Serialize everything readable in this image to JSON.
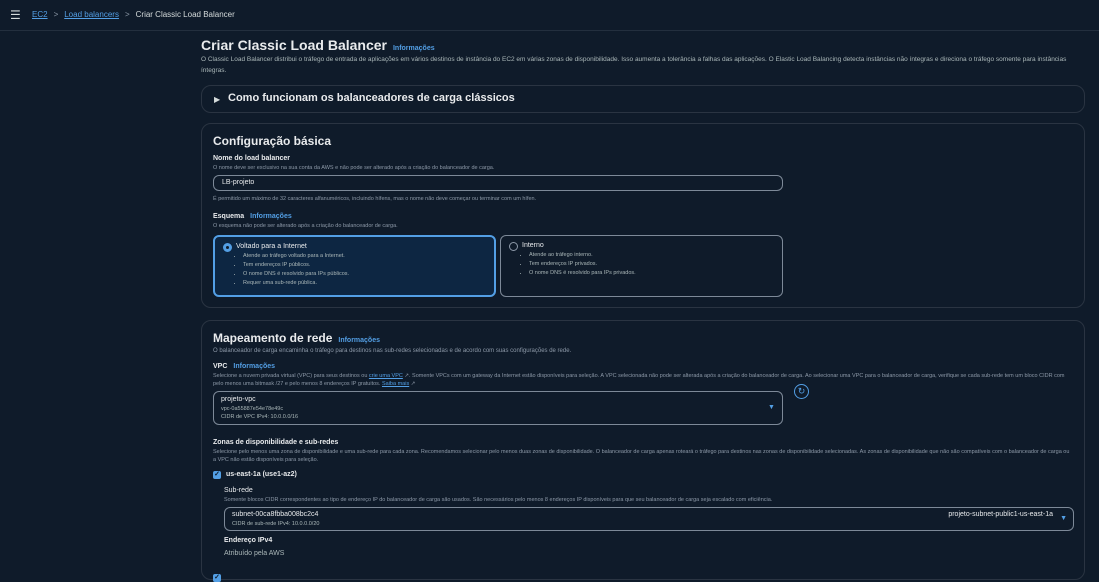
{
  "breadcrumb": {
    "root": "EC2",
    "parent": "Load balancers",
    "current": "Criar Classic Load Balancer"
  },
  "page": {
    "title": "Criar Classic Load Balancer",
    "info": "Informações",
    "intro": "O Classic Load Balancer distribui o tráfego de entrada de aplicações em vários destinos de instância do EC2 em várias zonas de disponibilidade. Isso aumenta a tolerância a falhas das aplicações. O Elastic Load Balancing detecta instâncias não íntegras e direciona o tráfego somente para instâncias íntegras."
  },
  "howto": {
    "label": "Como funcionam os balanceadores de carga clássicos"
  },
  "basic": {
    "title": "Configuração básica",
    "name_label": "Nome do load balancer",
    "name_desc": "O nome deve ser exclusivo na sua conta da AWS e não pode ser alterado após a criação do balanceador de carga.",
    "name_value": "LB-projeto",
    "name_hint": "É permitido um máximo de 32 caracteres alfanuméricos, incluindo hífens, mas o nome não deve começar ou terminar com um hífen.",
    "scheme_label": "Esquema",
    "scheme_info": "Informações",
    "scheme_desc": "O esquema não pode ser alterado após a criação do balanceador de carga.",
    "internet": {
      "title": "Voltado para a Internet",
      "items": [
        "Atende ao tráfego voltado para a Internet.",
        "Tem endereços IP públicos.",
        "O nome DNS é resolvido para IPs públicos.",
        "Requer uma sub-rede pública."
      ]
    },
    "internal": {
      "title": "Interno",
      "items": [
        "Atende ao tráfego interno.",
        "Tem endereços IP privados.",
        "O nome DNS é resolvido para IPs privados."
      ]
    }
  },
  "network": {
    "title": "Mapeamento de rede",
    "info": "Informações",
    "desc": "O balanceador de carga encaminha o tráfego para destinos nas sub-redes selecionadas e de acordo com suas configurações de rede.",
    "vpc_label": "VPC",
    "vpc_info": "Informações",
    "vpc_desc_a": "Selecione a nuvem privada virtual (VPC) para seus destinos ou",
    "vpc_desc_link": "crie uma VPC",
    "vpc_desc_b": ". Somente VPCs com um gateway da Internet estão disponíveis para seleção. A VPC selecionada não pode ser alterada após a criação do balanceador de carga. Ao selecionar uma VPC para o balanceador de carga, verifique se cada sub-rede tem um bloco CIDR com pelo menos uma bitmask /27 e pelo menos 8 endereços IP gratuitos.",
    "vpc_learn": "Saiba mais",
    "vpc_name": "projeto-vpc",
    "vpc_id": "vpc-0a55887e54e78e49c",
    "vpc_cidr": "CIDR de VPC IPv4: 10.0.0.0/16",
    "az_label": "Zonas de disponibilidade e sub-redes",
    "az_desc": "Selecione pelo menos uma zona de disponibilidade e uma sub-rede para cada zona. Recomendamos selecionar pelo menos duas zonas de disponibilidade. O balanceador de carga apenas roteará o tráfego para destinos nas zonas de disponibilidade selecionadas. As zonas de disponibilidade que não são compatíveis com o balanceador de carga ou a VPC não estão disponíveis para seleção.",
    "az_name": "us-east-1a (use1-az2)",
    "subnet_label": "Sub-rede",
    "subnet_desc": "Somente blocos CIDR correspondentes ao tipo de endereço IP do balanceador de carga são usados. São necessários pelo menos 8 endereços IP disponíveis para que seu balanceador de carga seja escalado com eficiência.",
    "subnet_id": "subnet-00ca8fbba008bc2c4",
    "subnet_cidr": "CIDR de sub-rede IPv4: 10.0.0.0/20",
    "subnet_name": "projeto-subnet-public1-us-east-1a",
    "ipv4_label": "Endereço IPv4",
    "ipv4_value": "Atribuído pela AWS"
  }
}
